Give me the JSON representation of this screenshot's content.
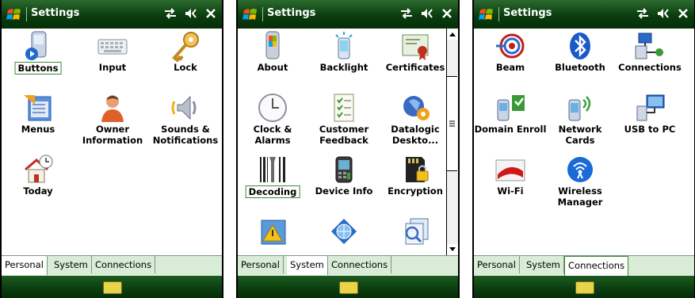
{
  "screens": [
    {
      "title": "Settings",
      "items": [
        {
          "label": "Buttons",
          "icon": "buttons-icon"
        },
        {
          "label": "Input",
          "icon": "keyboard-icon"
        },
        {
          "label": "Lock",
          "icon": "key-icon"
        },
        {
          "label": "Menus",
          "icon": "menus-icon"
        },
        {
          "label": "Owner Information",
          "icon": "owner-icon"
        },
        {
          "label": "Sounds & Notifications",
          "icon": "speaker-icon"
        },
        {
          "label": "Today",
          "icon": "today-icon"
        }
      ],
      "tabs": [
        "Personal",
        "System",
        "Connections"
      ]
    },
    {
      "title": "Settings",
      "items": [
        {
          "label": "About",
          "icon": "about-icon"
        },
        {
          "label": "Backlight",
          "icon": "backlight-icon"
        },
        {
          "label": "Certificates",
          "icon": "certificates-icon"
        },
        {
          "label": "Clock & Alarms",
          "icon": "clock-icon"
        },
        {
          "label": "Customer Feedback",
          "icon": "feedback-icon"
        },
        {
          "label": "Datalogic Deskto...",
          "icon": "datalogic-icon"
        },
        {
          "label": "Decoding",
          "icon": "decoding-icon"
        },
        {
          "label": "Device Info",
          "icon": "device-info-icon"
        },
        {
          "label": "Encryption",
          "icon": "encryption-icon"
        },
        {
          "label": "",
          "icon": "error-reporting-icon"
        },
        {
          "label": "",
          "icon": "globe-icon"
        },
        {
          "label": "",
          "icon": "memory-icon"
        }
      ],
      "tabs": [
        "Personal",
        "System",
        "Connections"
      ]
    },
    {
      "title": "Settings",
      "items": [
        {
          "label": "Beam",
          "icon": "beam-icon"
        },
        {
          "label": "Bluetooth",
          "icon": "bluetooth-icon"
        },
        {
          "label": "Connections",
          "icon": "connections-icon"
        },
        {
          "label": "Domain Enroll",
          "icon": "domain-enroll-icon"
        },
        {
          "label": "Network Cards",
          "icon": "network-cards-icon"
        },
        {
          "label": "USB to PC",
          "icon": "usb-icon"
        },
        {
          "label": "Wi-Fi",
          "icon": "wifi-icon"
        },
        {
          "label": "Wireless Manager",
          "icon": "wireless-manager-icon"
        }
      ],
      "tabs": [
        "Personal",
        "System",
        "Connections"
      ]
    }
  ],
  "colors": {
    "titlebar": "#0a3d0f",
    "tabbar": "#d8ecd8",
    "accent": "#3a8a3a"
  }
}
